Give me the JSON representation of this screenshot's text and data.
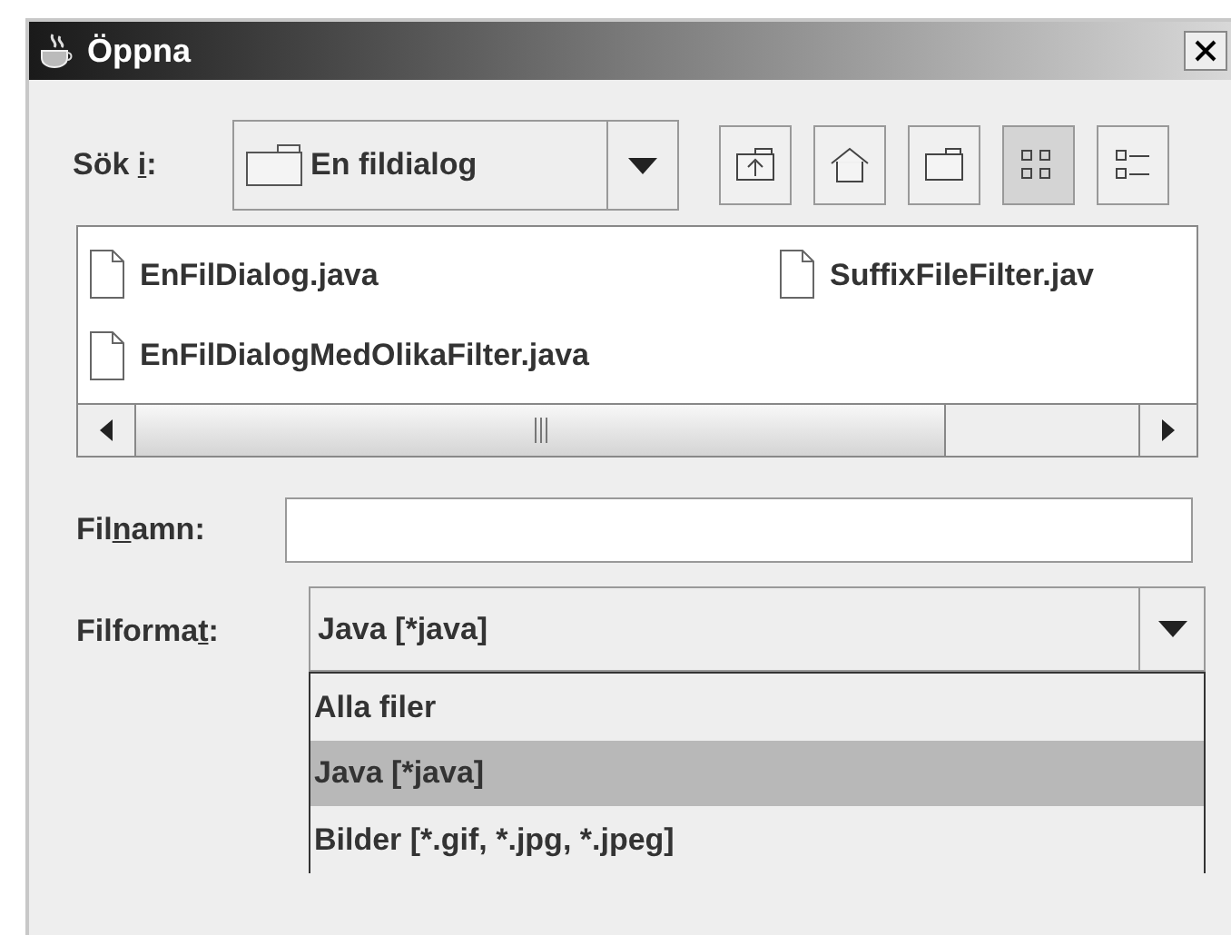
{
  "window": {
    "title": "Öppna"
  },
  "look_in": {
    "label": {
      "before": "Sök ",
      "mnemonic": "i",
      "after": ":"
    },
    "value": "En fildialog"
  },
  "toolbar": [
    {
      "kind": "up",
      "selected": false
    },
    {
      "kind": "home",
      "selected": false
    },
    {
      "kind": "new_folder",
      "selected": false
    },
    {
      "kind": "list",
      "selected": true
    },
    {
      "kind": "details",
      "selected": false
    }
  ],
  "files": [
    {
      "name": "EnFilDialog.java"
    },
    {
      "name": "EnFilDialogMedOlikaFilter.java"
    },
    {
      "name": "SuffixFileFilter.jav"
    }
  ],
  "file_name": {
    "label": {
      "before": "Fil",
      "mnemonic": "n",
      "after": "amn:"
    }
  },
  "file_format": {
    "label": {
      "before": "Filforma",
      "mnemonic": "t",
      "after": ":"
    },
    "value": "Java [*java]",
    "options": [
      {
        "label": "Alla filer",
        "selected": false
      },
      {
        "label": "Java [*java]",
        "selected": true
      },
      {
        "label": "Bilder [*.gif, *.jpg, *.jpeg]",
        "selected": false
      }
    ]
  }
}
